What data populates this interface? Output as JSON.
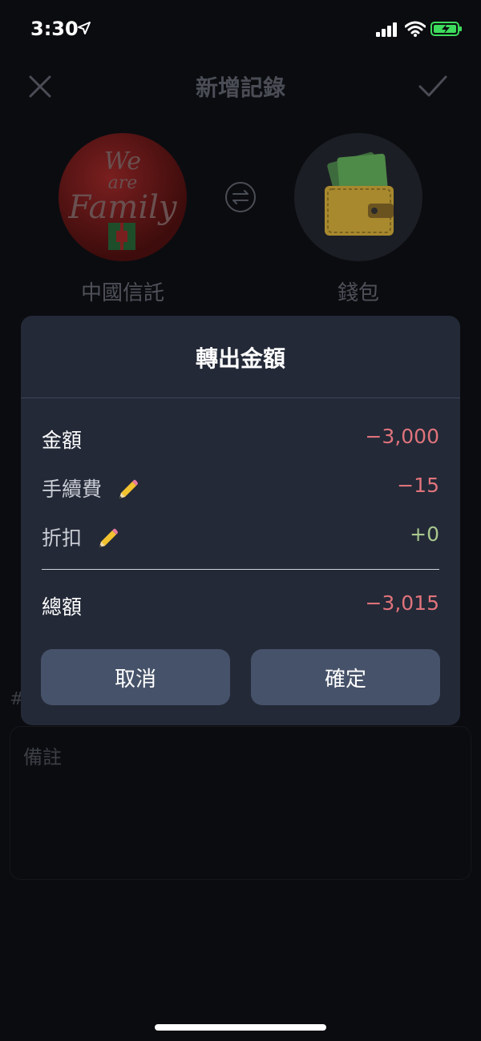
{
  "status": {
    "time": "3:30"
  },
  "nav": {
    "title": "新增記錄"
  },
  "transfer": {
    "from_account": "中國信託",
    "to_account": "錢包"
  },
  "logo": {
    "line1": "We",
    "line2": "are",
    "line3": "Family"
  },
  "memo": {
    "placeholder": "備註"
  },
  "background": {
    "hash_glyph": "#"
  },
  "modal": {
    "title": "轉出金額",
    "rows": [
      {
        "label": "金額",
        "value": "−3,000"
      },
      {
        "label": "手續費",
        "value": "−15"
      },
      {
        "label": "折扣",
        "value": "+0"
      }
    ],
    "total": {
      "label": "總額",
      "value": "−3,015"
    },
    "cancel_label": "取消",
    "confirm_label": "確定"
  },
  "colors": {
    "negative": "#e0737b",
    "positive": "#a9c78e",
    "modal_bg": "#232937",
    "button_bg": "#465269"
  },
  "icons": [
    "close-icon",
    "check-icon",
    "swap-icon",
    "wallet-icon",
    "pencil-icon",
    "location-arrow-icon",
    "signal-icon",
    "wifi-icon",
    "battery-icon"
  ]
}
